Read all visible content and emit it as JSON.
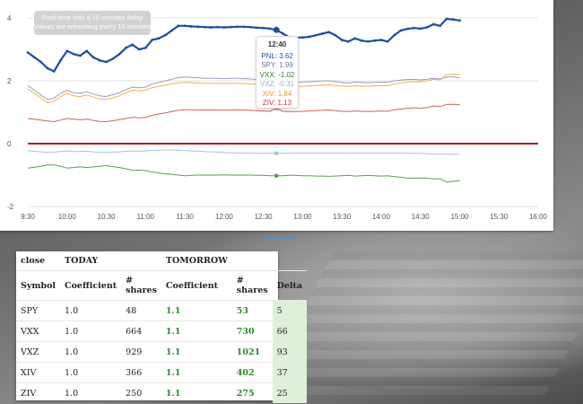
{
  "chart": {
    "notice": {
      "line1": "Real-time with a 15 minutes delay",
      "line2": "Values are refreshing every 10 minutes"
    },
    "y_ticks": [
      "4",
      "2",
      "0",
      "-2"
    ],
    "x_ticks": [
      "9:30",
      "10:00",
      "10:30",
      "11:00",
      "11:30",
      "12:00",
      "12:30",
      "13:00",
      "13:30",
      "14:00",
      "14:30",
      "15:00",
      "15:30",
      "16:00"
    ],
    "colors": {
      "PNL": "#1f4fa0",
      "SPY": "#9a9ab8",
      "VXX": "#55a34d",
      "VXZ": "#9fc3e6",
      "XIV": "#f0b04a",
      "ZIV": "#d0605c",
      "zero_line": "#b01c1c"
    },
    "tooltip": {
      "time": "12:40",
      "rows": [
        {
          "text": "PNL: 3.62",
          "color": "#1f4fa0"
        },
        {
          "text": "SPY: 1.99",
          "color": "#6f6f9a"
        },
        {
          "text": "VXX: -1.02",
          "color": "#2f7f2f"
        },
        {
          "text": "VXZ: -0.31",
          "color": "#8fb3d6"
        },
        {
          "text": "XIV: 1.84",
          "color": "#e19a25"
        },
        {
          "text": "ZIV: 1.13",
          "color": "#c53b36"
        }
      ]
    }
  },
  "chart_data": {
    "type": "line",
    "x": [
      "9:30",
      "9:35",
      "9:40",
      "9:45",
      "9:50",
      "9:55",
      "10:00",
      "10:05",
      "10:10",
      "10:15",
      "10:20",
      "10:25",
      "10:30",
      "10:35",
      "10:40",
      "10:45",
      "10:50",
      "10:55",
      "11:00",
      "11:05",
      "11:10",
      "11:15",
      "11:20",
      "11:25",
      "11:30",
      "11:35",
      "11:40",
      "11:45",
      "11:50",
      "11:55",
      "12:00",
      "12:05",
      "12:10",
      "12:15",
      "12:20",
      "12:25",
      "12:30",
      "12:35",
      "12:40",
      "12:45",
      "12:50",
      "12:55",
      "13:00",
      "13:05",
      "13:10",
      "13:15",
      "13:20",
      "13:25",
      "13:30",
      "13:35",
      "13:40",
      "13:45",
      "13:50",
      "13:55",
      "14:00",
      "14:05",
      "14:10",
      "14:15",
      "14:20",
      "14:25",
      "14:30",
      "14:35",
      "14:40",
      "14:45",
      "14:50",
      "14:55",
      "15:00"
    ],
    "series": [
      {
        "name": "PNL",
        "values": [
          2.9,
          2.75,
          2.6,
          2.4,
          2.3,
          2.65,
          2.95,
          2.85,
          2.8,
          2.95,
          2.75,
          2.65,
          2.6,
          2.7,
          2.85,
          3.05,
          3.15,
          3.0,
          3.05,
          3.3,
          3.35,
          3.45,
          3.6,
          3.75,
          3.75,
          3.73,
          3.72,
          3.71,
          3.7,
          3.71,
          3.7,
          3.71,
          3.72,
          3.72,
          3.71,
          3.69,
          3.68,
          3.66,
          3.62,
          3.5,
          3.38,
          3.37,
          3.38,
          3.4,
          3.45,
          3.5,
          3.55,
          3.45,
          3.3,
          3.25,
          3.35,
          3.28,
          3.25,
          3.28,
          3.3,
          3.25,
          3.45,
          3.6,
          3.65,
          3.68,
          3.66,
          3.7,
          3.8,
          3.75,
          3.97,
          3.95,
          3.92
        ]
      },
      {
        "name": "SPY",
        "values": [
          1.85,
          1.7,
          1.55,
          1.4,
          1.45,
          1.6,
          1.7,
          1.62,
          1.6,
          1.65,
          1.58,
          1.52,
          1.5,
          1.56,
          1.62,
          1.72,
          1.8,
          1.78,
          1.8,
          1.9,
          1.95,
          2.0,
          2.05,
          2.1,
          2.12,
          2.11,
          2.1,
          2.08,
          2.08,
          2.08,
          2.07,
          2.08,
          2.08,
          2.07,
          2.06,
          2.04,
          2.03,
          2.01,
          1.99,
          1.97,
          1.95,
          1.95,
          1.96,
          1.97,
          1.98,
          1.99,
          2.0,
          1.98,
          1.95,
          1.93,
          1.96,
          1.95,
          1.94,
          1.95,
          1.96,
          1.95,
          2.0,
          2.02,
          2.04,
          2.05,
          2.03,
          2.05,
          2.08,
          2.06,
          2.12,
          2.12,
          2.1
        ]
      },
      {
        "name": "XIV",
        "values": [
          1.75,
          1.6,
          1.45,
          1.3,
          1.35,
          1.5,
          1.6,
          1.52,
          1.5,
          1.55,
          1.48,
          1.42,
          1.4,
          1.46,
          1.52,
          1.62,
          1.7,
          1.68,
          1.7,
          1.78,
          1.82,
          1.86,
          1.9,
          1.94,
          1.95,
          1.94,
          1.93,
          1.92,
          1.92,
          1.92,
          1.91,
          1.92,
          1.92,
          1.91,
          1.9,
          1.89,
          1.88,
          1.86,
          1.84,
          1.83,
          1.82,
          1.82,
          1.83,
          1.84,
          1.85,
          1.86,
          1.87,
          1.85,
          1.83,
          1.82,
          1.84,
          1.83,
          1.83,
          1.84,
          1.85,
          1.84,
          1.9,
          1.93,
          1.96,
          1.98,
          1.97,
          2.0,
          2.05,
          2.03,
          2.2,
          2.21,
          2.2
        ]
      },
      {
        "name": "ZIV",
        "values": [
          0.8,
          0.78,
          0.75,
          0.72,
          0.7,
          0.75,
          0.8,
          0.78,
          0.76,
          0.78,
          0.74,
          0.71,
          0.7,
          0.73,
          0.76,
          0.8,
          0.84,
          0.82,
          0.84,
          0.9,
          0.94,
          0.98,
          1.02,
          1.06,
          1.08,
          1.08,
          1.07,
          1.07,
          1.07,
          1.07,
          1.06,
          1.07,
          1.07,
          1.07,
          1.06,
          1.05,
          1.04,
          1.03,
          1.13,
          1.03,
          1.02,
          1.02,
          1.03,
          1.04,
          1.05,
          1.06,
          1.07,
          1.05,
          1.03,
          1.02,
          1.04,
          1.03,
          1.02,
          1.03,
          1.04,
          1.03,
          1.08,
          1.1,
          1.12,
          1.14,
          1.13,
          1.15,
          1.2,
          1.18,
          1.25,
          1.25,
          1.24
        ]
      },
      {
        "name": "VXZ",
        "values": [
          -0.22,
          -0.24,
          -0.26,
          -0.28,
          -0.27,
          -0.25,
          -0.23,
          -0.25,
          -0.25,
          -0.24,
          -0.26,
          -0.27,
          -0.28,
          -0.27,
          -0.26,
          -0.24,
          -0.23,
          -0.24,
          -0.23,
          -0.22,
          -0.21,
          -0.2,
          -0.2,
          -0.21,
          -0.22,
          -0.23,
          -0.24,
          -0.25,
          -0.26,
          -0.27,
          -0.28,
          -0.29,
          -0.3,
          -0.3,
          -0.3,
          -0.31,
          -0.31,
          -0.31,
          -0.31,
          -0.31,
          -0.31,
          -0.3,
          -0.3,
          -0.3,
          -0.3,
          -0.3,
          -0.3,
          -0.3,
          -0.3,
          -0.31,
          -0.3,
          -0.3,
          -0.3,
          -0.3,
          -0.3,
          -0.3,
          -0.3,
          -0.3,
          -0.31,
          -0.31,
          -0.31,
          -0.32,
          -0.33,
          -0.33,
          -0.33,
          -0.34,
          -0.34
        ]
      },
      {
        "name": "VXX",
        "values": [
          -0.78,
          -0.75,
          -0.72,
          -0.68,
          -0.68,
          -0.72,
          -0.78,
          -0.76,
          -0.74,
          -0.76,
          -0.74,
          -0.72,
          -0.7,
          -0.73,
          -0.76,
          -0.8,
          -0.85,
          -0.84,
          -0.86,
          -0.9,
          -0.93,
          -0.96,
          -0.98,
          -1.0,
          -1.02,
          -1.01,
          -1.0,
          -1.0,
          -1.0,
          -1.0,
          -0.99,
          -1.0,
          -1.0,
          -1.0,
          -1.0,
          -1.01,
          -1.01,
          -1.02,
          -1.02,
          -1.02,
          -1.01,
          -1.01,
          -1.02,
          -1.02,
          -1.03,
          -1.03,
          -1.04,
          -1.03,
          -1.02,
          -1.01,
          -1.03,
          -1.02,
          -1.01,
          -1.02,
          -1.03,
          -1.02,
          -1.05,
          -1.07,
          -1.09,
          -1.1,
          -1.09,
          -1.1,
          -1.12,
          -1.12,
          -1.22,
          -1.2,
          -1.18
        ]
      }
    ],
    "ylim": [
      -2,
      4.2
    ],
    "xlim": [
      "9:30",
      "16:00"
    ],
    "grid": true,
    "zero_line": true
  },
  "table": {
    "header1": [
      "close",
      "TODAY",
      "",
      "TOMORROW",
      "",
      ""
    ],
    "header2": [
      "Symbol",
      "Coefficient",
      "# shares",
      "Coefficient",
      "# shares",
      "Delta"
    ],
    "rows": [
      [
        "SPY",
        "1.0",
        "48",
        "1.1",
        "53",
        "5"
      ],
      [
        "VXX",
        "1.0",
        "664",
        "1.1",
        "730",
        "66"
      ],
      [
        "VXZ",
        "1.0",
        "929",
        "1.1",
        "1021",
        "93"
      ],
      [
        "XIV",
        "1.0",
        "366",
        "1.1",
        "402",
        "37"
      ],
      [
        "ZIV",
        "1.0",
        "250",
        "1.1",
        "275",
        "25"
      ]
    ]
  }
}
